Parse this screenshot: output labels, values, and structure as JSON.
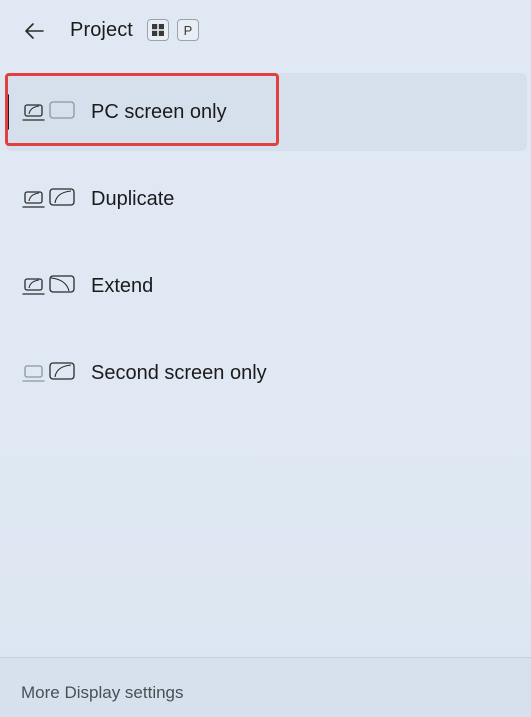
{
  "header": {
    "title": "Project",
    "shortcut_keys": [
      "⊞",
      "P"
    ]
  },
  "options": [
    {
      "label": "PC screen only",
      "icon": "pc-screen-only-icon",
      "selected": true
    },
    {
      "label": "Duplicate",
      "icon": "duplicate-icon",
      "selected": false
    },
    {
      "label": "Extend",
      "icon": "extend-icon",
      "selected": false
    },
    {
      "label": "Second screen only",
      "icon": "second-screen-only-icon",
      "selected": false
    }
  ],
  "footer": {
    "link_label": "More Display settings"
  },
  "colors": {
    "background": "#dfe8f3",
    "selected_row": "#d6e0ec",
    "highlight_border": "#e0403f",
    "text": "#1b1b1b"
  }
}
